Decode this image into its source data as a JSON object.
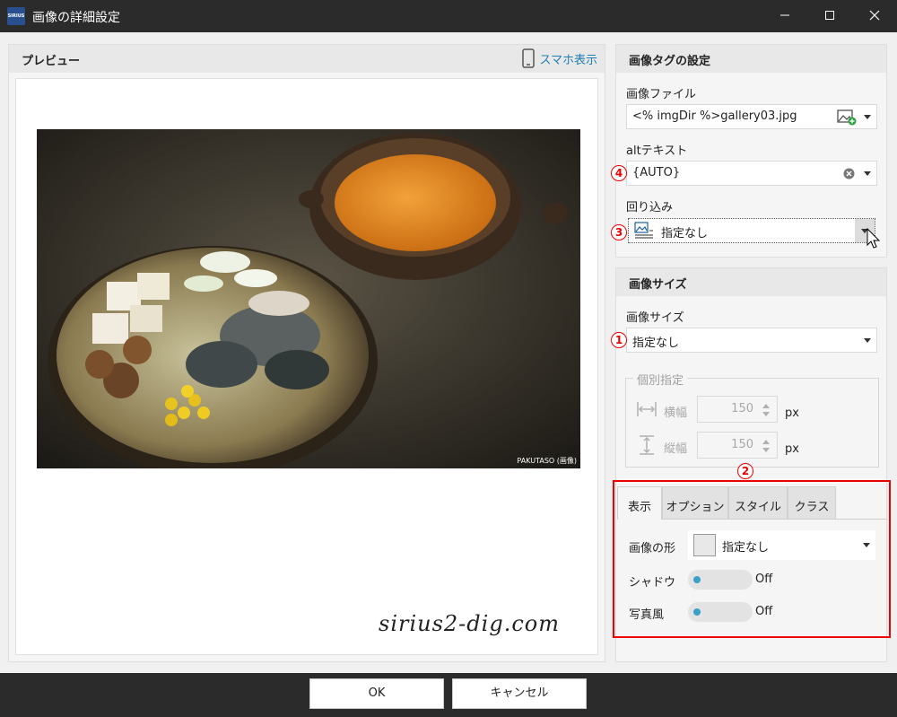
{
  "window": {
    "title": "画像の詳細設定",
    "app_icon_text": "SIRIUS",
    "minimize_icon": "minimize-icon",
    "maximize_icon": "maximize-icon",
    "close_icon": "close-icon"
  },
  "preview": {
    "header": "プレビュー",
    "mobile_link": "スマホ表示",
    "photo_credit": "PAKUTASO (画像)",
    "watermark": "sirius2-dig.com"
  },
  "image_tag": {
    "header": "画像タグの設定",
    "file_label": "画像ファイル",
    "file_value": "<% imgDir %>gallery03.jpg",
    "alt_label": "altテキスト",
    "alt_value": "{AUTO}",
    "wrap_label": "回り込み",
    "wrap_value": "指定なし"
  },
  "image_size": {
    "header": "画像サイズ",
    "size_label": "画像サイズ",
    "size_value": "指定なし",
    "individual_title": "個別指定",
    "width_label": "横幅",
    "width_value": "150",
    "width_unit": "px",
    "height_label": "縦幅",
    "height_value": "150",
    "height_unit": "px"
  },
  "tabs": [
    {
      "label": "表示"
    },
    {
      "label": "オプション"
    },
    {
      "label": "スタイル"
    },
    {
      "label": "クラス"
    }
  ],
  "display_tab": {
    "shape_label": "画像の形",
    "shape_value": "指定なし",
    "shadow_label": "シャドウ",
    "shadow_state": "Off",
    "photo_label": "写真風",
    "photo_state": "Off"
  },
  "badges": [
    "1",
    "2",
    "3",
    "4"
  ],
  "buttons": {
    "ok": "OK",
    "cancel": "キャンセル"
  },
  "colors": {
    "title_bar": "#2b2b2b",
    "accent_link": "#1f7fb5",
    "annotation_red": "#e00000",
    "toggle_dot": "#3aa0c8"
  }
}
